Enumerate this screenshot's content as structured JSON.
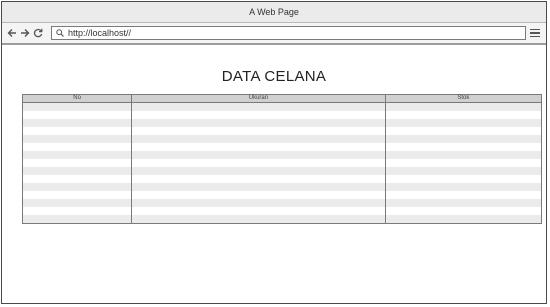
{
  "window": {
    "title": "A Web Page"
  },
  "toolbar": {
    "back_icon": "back-arrow-icon",
    "forward_icon": "forward-arrow-icon",
    "reload_icon": "reload-icon",
    "url": "http://localhost//",
    "menu_icon": "hamburger-menu-icon"
  },
  "page": {
    "heading": "DATA CELANA"
  },
  "table": {
    "columns": [
      "No",
      "Ukuran",
      "Stok"
    ],
    "rows": [
      [
        "",
        "",
        ""
      ],
      [
        "",
        "",
        ""
      ],
      [
        "",
        "",
        ""
      ],
      [
        "",
        "",
        ""
      ],
      [
        "",
        "",
        ""
      ],
      [
        "",
        "",
        ""
      ],
      [
        "",
        "",
        ""
      ],
      [
        "",
        "",
        ""
      ],
      [
        "",
        "",
        ""
      ],
      [
        "",
        "",
        ""
      ],
      [
        "",
        "",
        ""
      ],
      [
        "",
        "",
        ""
      ],
      [
        "",
        "",
        ""
      ],
      [
        "",
        "",
        ""
      ],
      [
        "",
        "",
        ""
      ]
    ]
  },
  "colors": {
    "header_bg": "#d0d0d0",
    "stripe_bg": "#ebebeb",
    "border": "#7a7a7a"
  }
}
